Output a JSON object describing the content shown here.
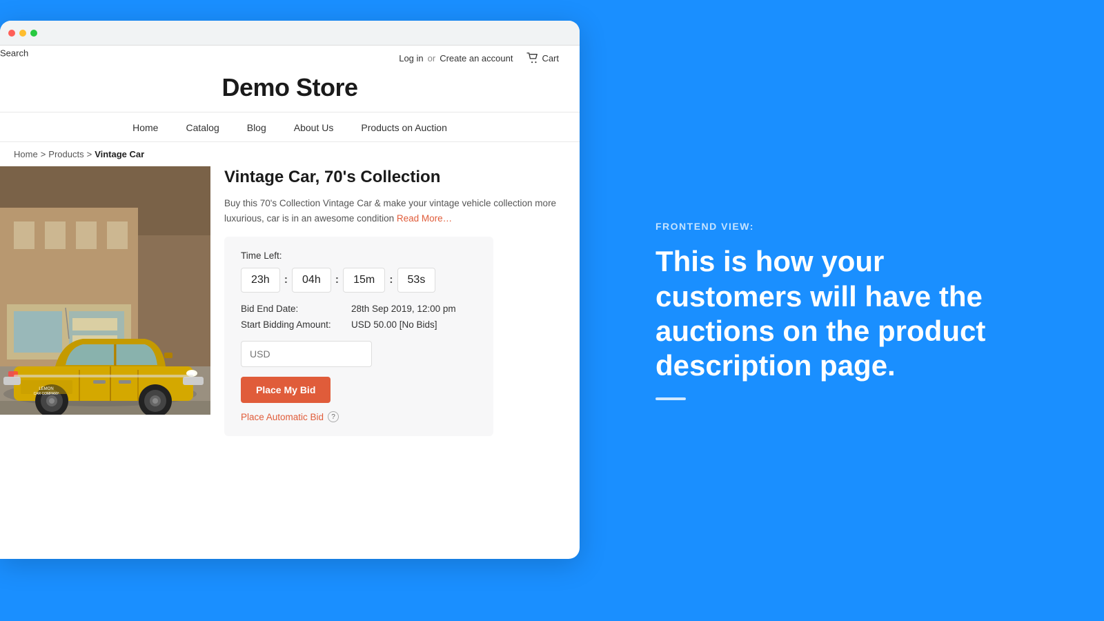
{
  "browser": {
    "dots": [
      "red",
      "yellow",
      "green"
    ]
  },
  "store": {
    "search_label": "Search",
    "login_label": "Log in",
    "or_label": "or",
    "create_account_label": "Create an account",
    "cart_label": "Cart",
    "title": "Demo Store",
    "nav_items": [
      "Home",
      "Catalog",
      "Blog",
      "About Us",
      "Products on Auction"
    ]
  },
  "breadcrumb": {
    "home": "Home",
    "sep1": ">",
    "products": "Products",
    "sep2": ">",
    "current": "Vintage Car"
  },
  "product": {
    "title": "Vintage Car, 70's Collection",
    "description": "Buy this 70's Collection Vintage Car & make your vintage vehicle collection more luxurious, car is in an awesome condition",
    "read_more": "Read More…"
  },
  "auction": {
    "time_left_label": "Time Left:",
    "timer": {
      "hours": "23h",
      "sep1": ":",
      "minutes": "04h",
      "sep2": ":",
      "seconds": "15m",
      "sep3": ":",
      "ms": "53s"
    },
    "bid_end_label": "Bid End Date:",
    "bid_end_value": "28th Sep 2019, 12:00 pm",
    "start_bid_label": "Start Bidding Amount:",
    "start_bid_value": "USD 50.00  [No Bids]",
    "input_placeholder": "USD",
    "place_bid_button": "Place My Bid",
    "auto_bid_label": "Place Automatic Bid",
    "help_icon": "?"
  },
  "sidebar": {
    "frontend_label": "FRONTEND VIEW:",
    "heading_line1": "This is how your",
    "heading_line2": "customers will have the",
    "heading_line3": "auctions on the product",
    "heading_line4": "description page."
  }
}
